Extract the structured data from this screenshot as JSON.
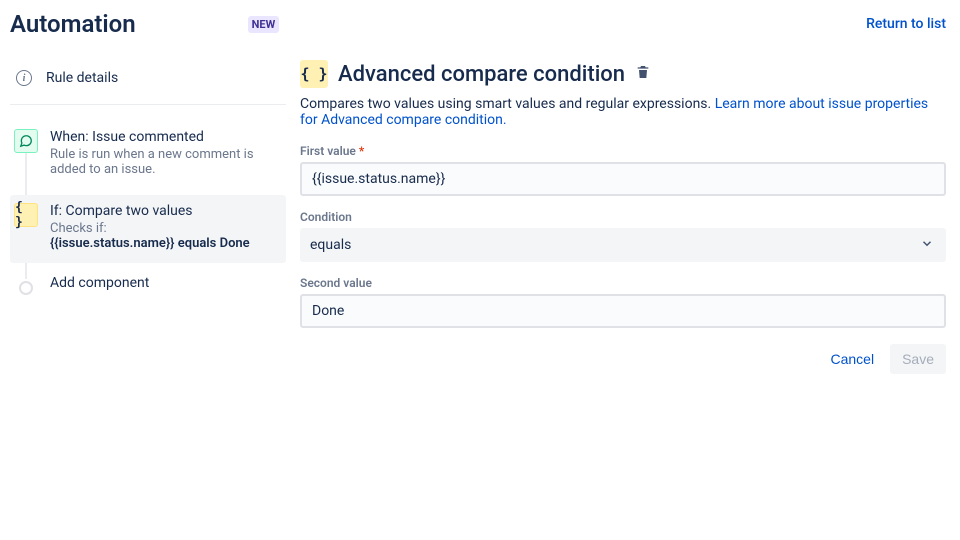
{
  "header": {
    "title": "Automation",
    "new_badge": "NEW",
    "return_link": "Return to list"
  },
  "sidebar": {
    "rule_details_label": "Rule details",
    "trigger": {
      "title": "When: Issue commented",
      "subtitle": "Rule is run when a new comment is added to an issue."
    },
    "condition": {
      "title": "If: Compare two values",
      "subtitle_prefix": "Checks if:",
      "subtitle_detail": "{{issue.status.name}} equals Done"
    },
    "add_component": "Add component"
  },
  "detail": {
    "icon_glyph": "{ }",
    "title": "Advanced compare condition",
    "description_text": "Compares two values using smart values and regular expressions. ",
    "description_link": "Learn more about issue properties for Advanced compare condition.",
    "first_value_label": "First value",
    "first_value": "{{issue.status.name}}",
    "condition_label": "Condition",
    "condition_value": "equals",
    "second_value_label": "Second value",
    "second_value": "Done",
    "cancel": "Cancel",
    "save": "Save"
  }
}
